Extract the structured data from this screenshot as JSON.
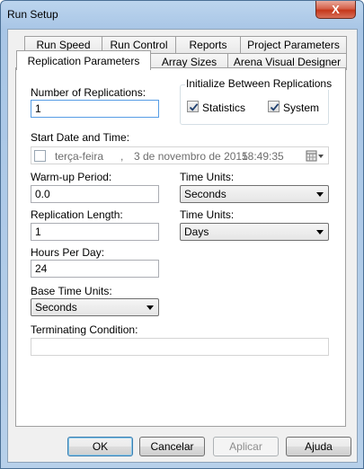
{
  "window": {
    "title": "Run Setup",
    "close_label": "X"
  },
  "tabs_row1": [
    "Run Speed",
    "Run Control",
    "Reports",
    "Project Parameters"
  ],
  "tabs_row2": [
    "Replication Parameters",
    "Array Sizes",
    "Arena Visual Designer"
  ],
  "form": {
    "num_replications_label": "Number of Replications:",
    "num_replications_value": "1",
    "init_group_label": "Initialize Between Replications",
    "statistics_label": "Statistics",
    "system_label": "System",
    "statistics_checked": true,
    "system_checked": true,
    "start_date_label": "Start Date and Time:",
    "start_date_day": "terça-feira",
    "start_date_sep": ",",
    "start_date_date": "3 de novembro de 2015",
    "start_date_time": "18:49:35",
    "warmup_label": "Warm-up Period:",
    "warmup_value": "0.0",
    "time_units_label_1": "Time Units:",
    "time_units_value_1": "Seconds",
    "rep_length_label": "Replication Length:",
    "rep_length_value": "1",
    "time_units_label_2": "Time Units:",
    "time_units_value_2": "Days",
    "hours_per_day_label": "Hours Per Day:",
    "hours_per_day_value": "24",
    "base_time_units_label": "Base Time Units:",
    "base_time_units_value": "Seconds",
    "terminating_label": "Terminating Condition:",
    "terminating_value": ""
  },
  "buttons": {
    "ok": "OK",
    "cancel": "Cancelar",
    "apply": "Aplicar",
    "help": "Ajuda"
  }
}
